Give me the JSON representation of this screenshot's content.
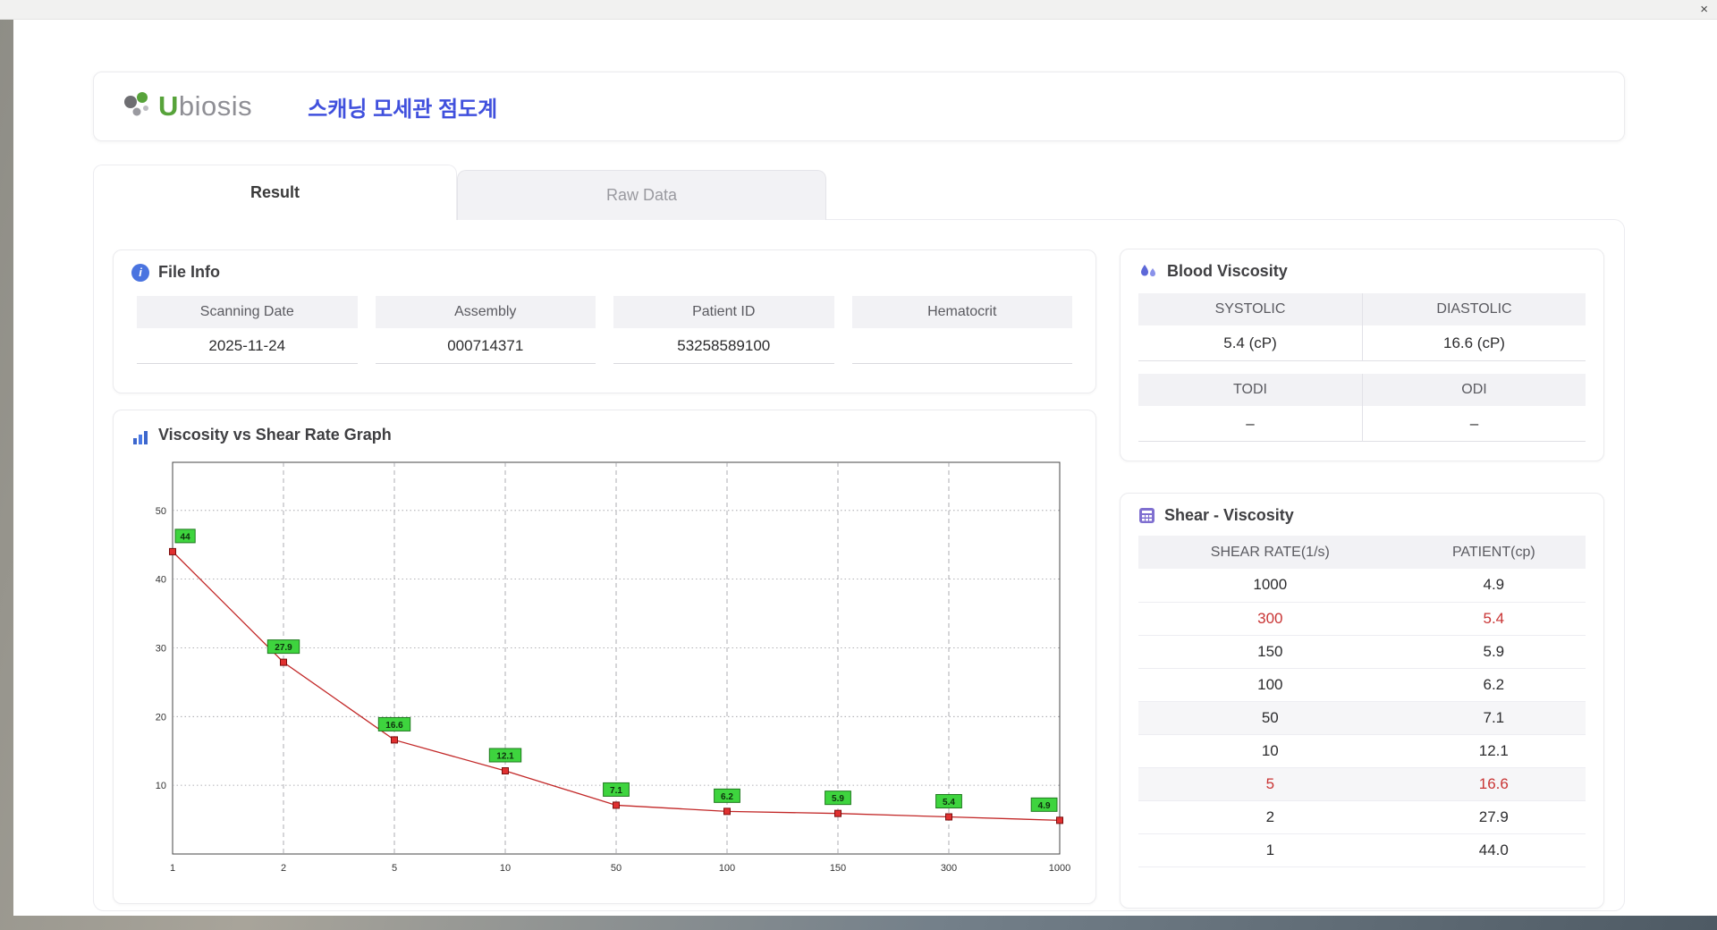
{
  "window": {
    "close_label": "×"
  },
  "header": {
    "logo_first": "U",
    "logo_rest": "biosis",
    "title": "스캐닝 모세관 점도계"
  },
  "tabs": [
    {
      "label": "Result",
      "active": true
    },
    {
      "label": "Raw Data",
      "active": false
    }
  ],
  "file_info": {
    "title": "File Info",
    "fields": [
      {
        "label": "Scanning Date",
        "value": "2025-11-24"
      },
      {
        "label": "Assembly",
        "value": "000714371"
      },
      {
        "label": "Patient ID",
        "value": "53258589100"
      },
      {
        "label": "Hematocrit",
        "value": ""
      }
    ]
  },
  "blood_viscosity": {
    "title": "Blood Viscosity",
    "groups": [
      [
        {
          "label": "SYSTOLIC",
          "value": "5.4 (cP)"
        },
        {
          "label": "DIASTOLIC",
          "value": "16.6 (cP)"
        }
      ],
      [
        {
          "label": "TODI",
          "value": "–"
        },
        {
          "label": "ODI",
          "value": "–"
        }
      ]
    ]
  },
  "graph": {
    "title": "Viscosity vs Shear Rate Graph"
  },
  "chart_data": {
    "type": "line",
    "title": "Viscosity vs Shear Rate Graph",
    "x_categories": [
      "1",
      "2",
      "5",
      "10",
      "50",
      "100",
      "150",
      "300",
      "1000"
    ],
    "values": [
      44,
      27.9,
      16.6,
      12.1,
      7.1,
      6.2,
      5.9,
      5.4,
      4.9
    ],
    "point_labels": [
      "44",
      "27.9",
      "16.6",
      "12.1",
      "7.1",
      "6.2",
      "5.9",
      "5.4",
      "4.9"
    ],
    "yticks": [
      10,
      20,
      30,
      40,
      50
    ],
    "ylim": [
      0,
      57
    ],
    "xlabel": "",
    "ylabel": "",
    "x_axis_scale": "category",
    "grid": true,
    "legend": "none",
    "line_color": "#c22727",
    "marker_color": "#e03030",
    "marker_border": "#7a0d0d",
    "label_bg": "#3ed43e",
    "label_border": "#1f7a1f"
  },
  "shear_table": {
    "title": "Shear - Viscosity",
    "headers": [
      "SHEAR RATE(1/s)",
      "PATIENT(cp)"
    ],
    "rows": [
      {
        "shear": "1000",
        "patient": "4.9",
        "highlight": false,
        "shaded": false
      },
      {
        "shear": "300",
        "patient": "5.4",
        "highlight": true,
        "shaded": false
      },
      {
        "shear": "150",
        "patient": "5.9",
        "highlight": false,
        "shaded": false
      },
      {
        "shear": "100",
        "patient": "6.2",
        "highlight": false,
        "shaded": false
      },
      {
        "shear": "50",
        "patient": "7.1",
        "highlight": false,
        "shaded": true
      },
      {
        "shear": "10",
        "patient": "12.1",
        "highlight": false,
        "shaded": false
      },
      {
        "shear": "5",
        "patient": "16.6",
        "highlight": true,
        "shaded": true
      },
      {
        "shear": "2",
        "patient": "27.9",
        "highlight": false,
        "shaded": false
      },
      {
        "shear": "1",
        "patient": "44.0",
        "highlight": false,
        "shaded": false
      }
    ]
  }
}
